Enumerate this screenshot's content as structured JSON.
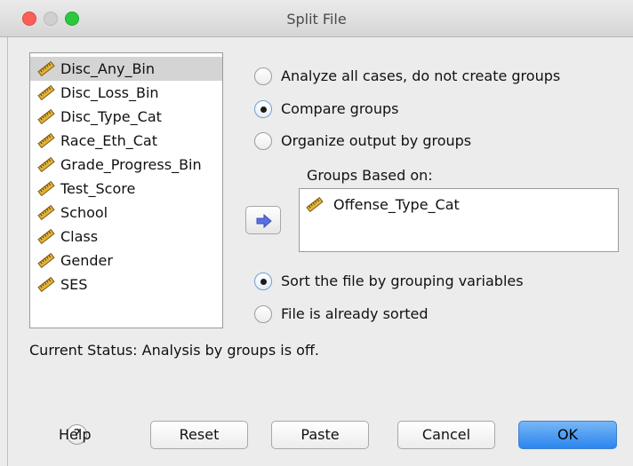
{
  "window": {
    "title": "Split File"
  },
  "variables": [
    {
      "label": "Disc_Any_Bin",
      "selected": true
    },
    {
      "label": "Disc_Loss_Bin"
    },
    {
      "label": "Disc_Type_Cat"
    },
    {
      "label": "Race_Eth_Cat"
    },
    {
      "label": "Grade_Progress_Bin"
    },
    {
      "label": "Test_Score"
    },
    {
      "label": "School"
    },
    {
      "label": "Class"
    },
    {
      "label": "Gender"
    },
    {
      "label": "SES"
    }
  ],
  "analysis_mode": {
    "options": [
      {
        "label": "Analyze all cases, do not create groups",
        "checked": false
      },
      {
        "label": "Compare groups",
        "checked": true
      },
      {
        "label": "Organize output by groups",
        "checked": false
      }
    ]
  },
  "groups": {
    "label": "Groups Based on:",
    "items": [
      {
        "label": "Offense_Type_Cat"
      }
    ]
  },
  "sort_mode": {
    "options": [
      {
        "label": "Sort the file by grouping variables",
        "checked": true
      },
      {
        "label": "File is already sorted",
        "checked": false
      }
    ]
  },
  "status": {
    "text": "Current Status: Analysis by groups is off."
  },
  "buttons": {
    "help": "Help",
    "help_glyph": "?",
    "reset": "Reset",
    "paste": "Paste",
    "cancel": "Cancel",
    "ok": "OK"
  },
  "icons": {
    "variable": "scale-ruler-icon",
    "move": "arrow-right-icon",
    "help": "help-icon"
  },
  "colors": {
    "close": "#fc5f57",
    "minimize": "#d0d0d0",
    "maximize": "#2bc840",
    "default_button": "#2a86ee",
    "ruler": "#e2b33a"
  }
}
